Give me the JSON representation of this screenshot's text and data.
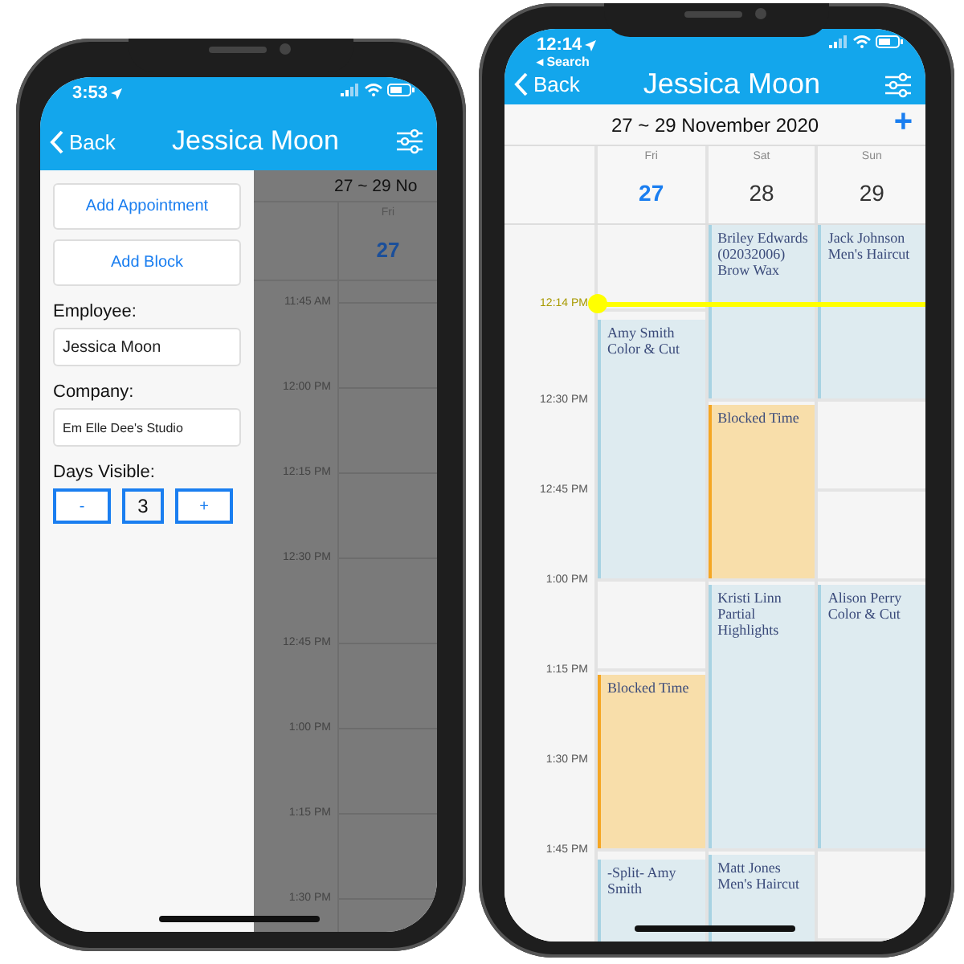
{
  "left_phone": {
    "status_time": "3:53",
    "nav": {
      "back": "Back",
      "title": "Jessica Moon"
    },
    "side_panel": {
      "buttons": [
        "Add Appointment",
        "Add Block"
      ],
      "fields": [
        {
          "label": "Employee:",
          "value": "Jessica Moon"
        },
        {
          "label": "Company:",
          "value": "Em Elle Dee's Studio"
        }
      ],
      "days_visible": {
        "label": "Days Visible:",
        "minus": "-",
        "value": "3",
        "plus": "+"
      }
    },
    "calendar": {
      "range": "27 ~ 29 No",
      "days": [
        {
          "name": "Fri",
          "date": "27",
          "today": true
        }
      ],
      "times": [
        "11:45 AM",
        "12:00 PM",
        "12:15 PM",
        "12:30 PM",
        "12:45 PM",
        "1:00 PM",
        "1:15 PM",
        "1:30 PM"
      ]
    }
  },
  "right_phone": {
    "status_time": "12:14",
    "back_to": "◂ Search",
    "nav": {
      "back": "Back",
      "title": "Jessica Moon"
    },
    "calendar": {
      "range": "27 ~ 29 November 2020",
      "add": "+",
      "current_time": "12:14 PM",
      "times": [
        "12:30 PM",
        "12:45 PM",
        "1:00 PM",
        "1:15 PM",
        "1:30 PM",
        "1:45 PM"
      ],
      "days": [
        {
          "name": "Fri",
          "date": "27",
          "today": true,
          "events": [
            {
              "kind": "appointment",
              "lines": [
                "Amy Smith",
                "Color & Cut"
              ]
            },
            {
              "kind": "blocked",
              "lines": [
                "Blocked Time"
              ]
            },
            {
              "kind": "appointment",
              "lines": [
                "-Split- Amy",
                "Smith"
              ]
            }
          ]
        },
        {
          "name": "Sat",
          "date": "28",
          "today": false,
          "events": [
            {
              "kind": "appointment",
              "lines": [
                "Briley Edwards",
                "(02032006)",
                "Brow Wax"
              ]
            },
            {
              "kind": "blocked",
              "lines": [
                "Blocked Time"
              ]
            },
            {
              "kind": "appointment",
              "lines": [
                "Kristi Linn",
                "Partial",
                "Highlights"
              ]
            },
            {
              "kind": "appointment",
              "lines": [
                "Matt Jones",
                "Men's Haircut"
              ]
            }
          ]
        },
        {
          "name": "Sun",
          "date": "29",
          "today": false,
          "events": [
            {
              "kind": "appointment",
              "lines": [
                "Jack Johnson",
                "Men's Haircut"
              ]
            },
            {
              "kind": "appointment",
              "lines": [
                "Alison Perry",
                "Color & Cut"
              ]
            }
          ]
        }
      ]
    }
  }
}
